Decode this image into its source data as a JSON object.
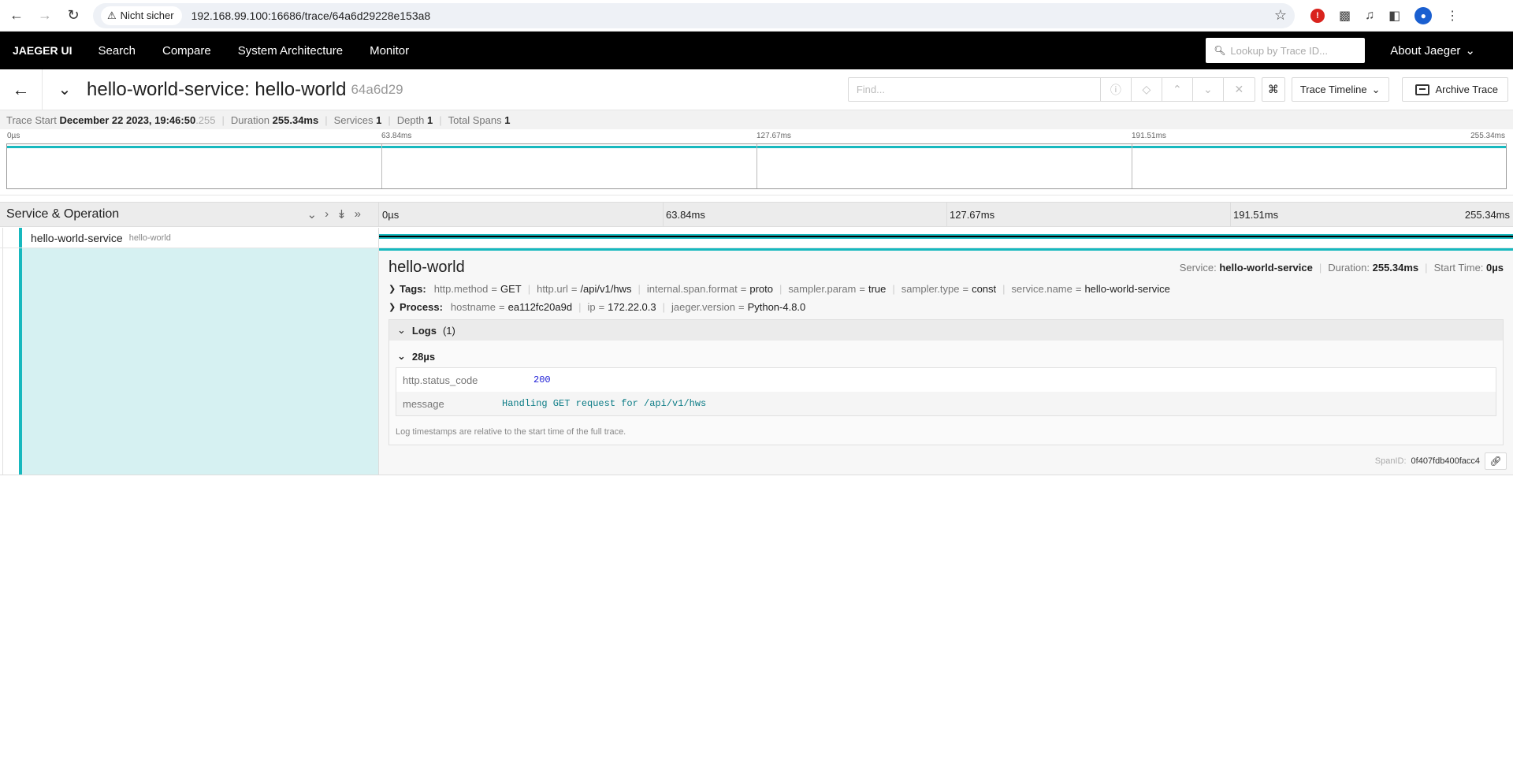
{
  "browser": {
    "insecure_label": "Nicht sicher",
    "url": "192.168.99.100:16686/trace/64a6d29228e153a8"
  },
  "topnav": {
    "brand": "JAEGER UI",
    "items": [
      "Search",
      "Compare",
      "System Architecture",
      "Monitor"
    ],
    "lookup_placeholder": "Lookup by Trace ID...",
    "about": "About Jaeger"
  },
  "trace": {
    "title": "hello-world-service: hello-world",
    "short_id": "64a6d29",
    "find_placeholder": "Find...",
    "timeline_label": "Trace Timeline",
    "archive_label": "Archive Trace"
  },
  "summary": {
    "trace_start_label": "Trace Start",
    "trace_start_value": "December 22 2023, 19:46:50",
    "trace_start_ms": ".255",
    "duration_label": "Duration",
    "duration_value": "255.34ms",
    "services_label": "Services",
    "services_value": "1",
    "depth_label": "Depth",
    "depth_value": "1",
    "total_spans_label": "Total Spans",
    "total_spans_value": "1"
  },
  "ticks": [
    "0µs",
    "63.84ms",
    "127.67ms",
    "191.51ms",
    "255.34ms"
  ],
  "timeline_header": {
    "title": "Service & Operation"
  },
  "span": {
    "service": "hello-world-service",
    "operation": "hello-world"
  },
  "detail": {
    "operation": "hello-world",
    "service_label": "Service:",
    "service_value": "hello-world-service",
    "duration_label": "Duration:",
    "duration_value": "255.34ms",
    "start_label": "Start Time:",
    "start_value": "0µs",
    "tags_label": "Tags:",
    "tags": [
      {
        "k": "http.method",
        "v": "GET"
      },
      {
        "k": "http.url",
        "v": "/api/v1/hws"
      },
      {
        "k": "internal.span.format",
        "v": "proto"
      },
      {
        "k": "sampler.param",
        "v": "true"
      },
      {
        "k": "sampler.type",
        "v": "const"
      },
      {
        "k": "service.name",
        "v": "hello-world-service"
      }
    ],
    "process_label": "Process:",
    "process": [
      {
        "k": "hostname",
        "v": "ea112fc20a9d"
      },
      {
        "k": "ip",
        "v": "172.22.0.3"
      },
      {
        "k": "jaeger.version",
        "v": "Python-4.8.0"
      }
    ],
    "logs_label": "Logs",
    "logs_count": "(1)",
    "log_time": "28µs",
    "log_fields": [
      {
        "k": "http.status_code",
        "v": "200"
      },
      {
        "k": "message",
        "v": "Handling GET request for /api/v1/hws"
      }
    ],
    "log_note": "Log timestamps are relative to the start time of the full trace.",
    "spanid_label": "SpanID:",
    "spanid_value": "0f407fdb400facc4"
  },
  "colors": {
    "accent": "#17b8be",
    "nav_bg": "#000000"
  }
}
